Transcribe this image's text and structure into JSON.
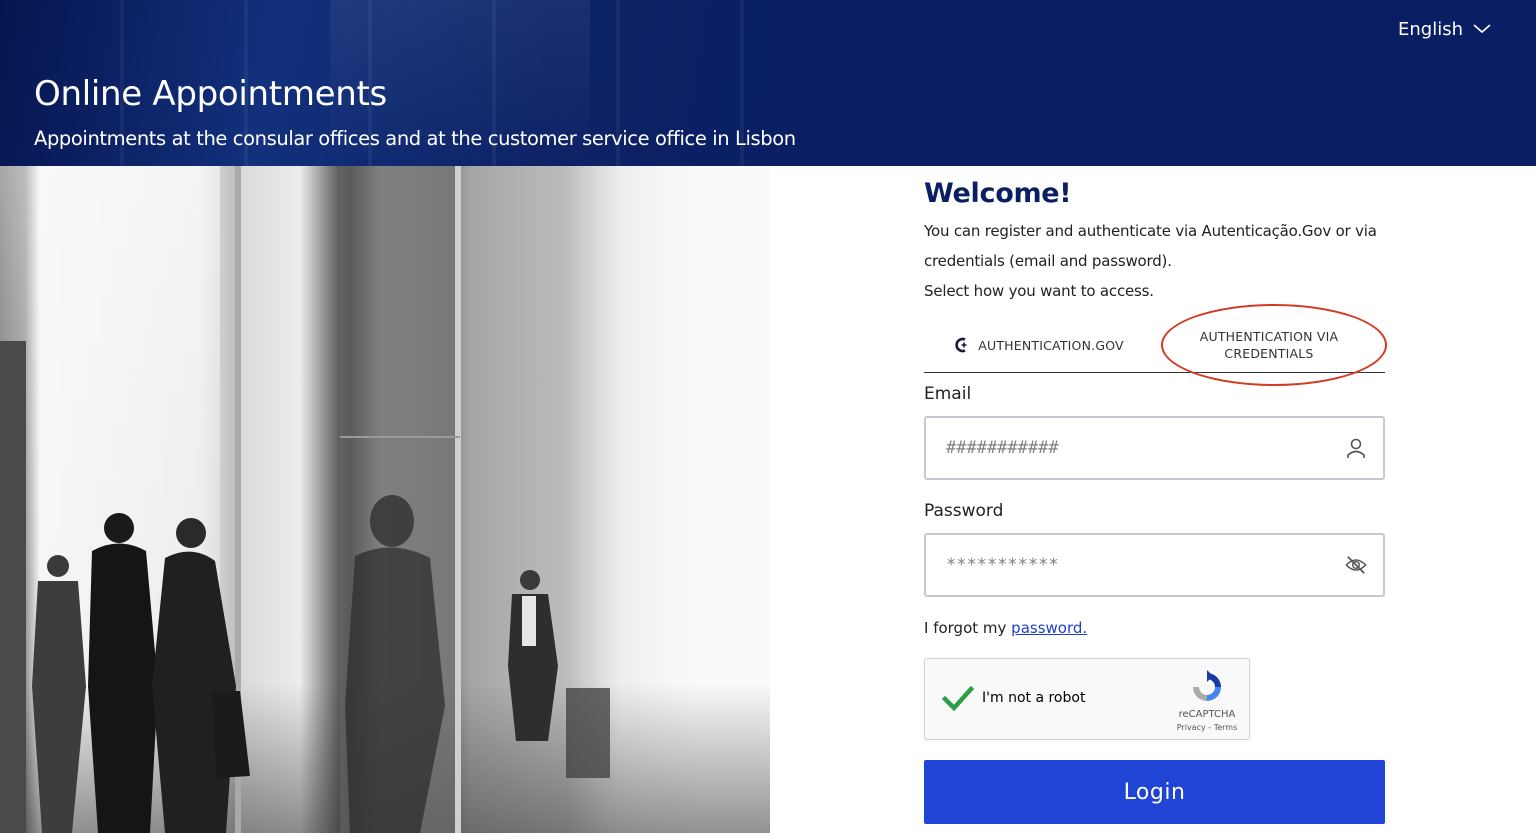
{
  "header": {
    "title": "Online Appointments",
    "subtitle": "Appointments at the consular offices and at the customer service office in Lisbon",
    "language": "English"
  },
  "main": {
    "welcome": "Welcome!",
    "intro_line1": "You can register and authenticate via Autenticação.Gov or via credentials (email and password).",
    "intro_line2": "Select how you want to access.",
    "tabs": [
      {
        "label": "AUTHENTICATION.GOV",
        "icon": "gov-auth-icon"
      },
      {
        "label": "AUTHENTICATION VIA CREDENTIALS"
      }
    ],
    "email": {
      "label": "Email",
      "placeholder": "###########",
      "icon": "user-icon"
    },
    "password": {
      "label": "Password",
      "placeholder": "***********",
      "icon": "eye-slash-icon"
    },
    "forgot_prefix": "I forgot my",
    "forgot_link": "password.",
    "captcha": {
      "label": "I'm not a robot",
      "brand": "reCAPTCHA",
      "terms": "Privacy - Terms",
      "checked": true
    },
    "login_label": "Login"
  },
  "colors": {
    "header_bg": "#0a1f63",
    "accent": "#1f44d6",
    "highlight": "#d33a22"
  }
}
